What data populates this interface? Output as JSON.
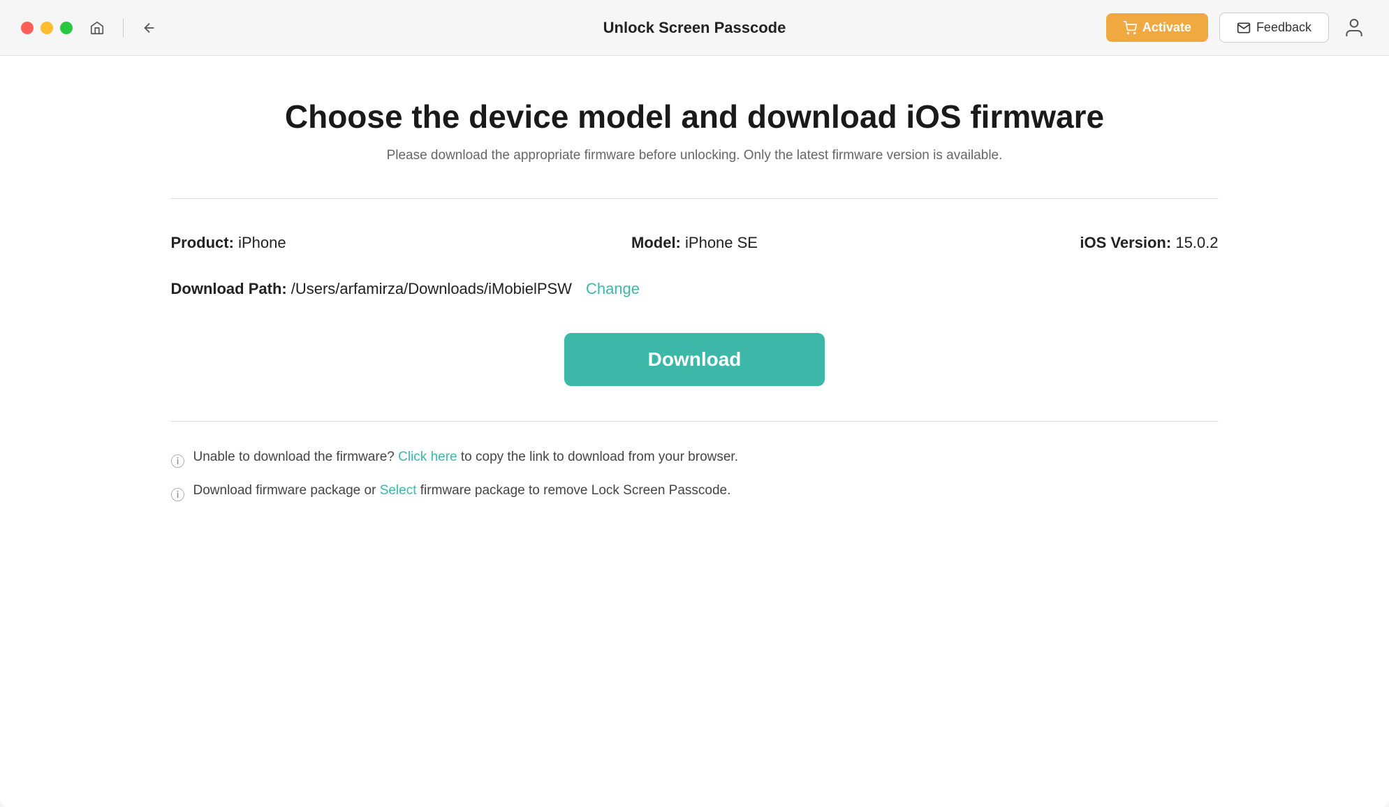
{
  "titleBar": {
    "title": "Unlock Screen Passcode",
    "activateLabel": "Activate",
    "feedbackLabel": "Feedback"
  },
  "page": {
    "mainTitle": "Choose the device model and download iOS firmware",
    "subtitle": "Please download the appropriate firmware before unlocking. Only the latest firmware version is available."
  },
  "deviceInfo": {
    "productLabel": "Product:",
    "productValue": "iPhone",
    "modelLabel": "Model:",
    "modelValue": "iPhone SE",
    "iosVersionLabel": "iOS Version:",
    "iosVersionValue": "15.0.2",
    "downloadPathLabel": "Download Path:",
    "downloadPathValue": "/Users/arfamirza/Downloads/iMobielPSW",
    "changeLabel": "Change"
  },
  "downloadButton": {
    "label": "Download"
  },
  "helpSection": {
    "item1": {
      "prefix": "Unable to download the firmware?",
      "linkText": "Click here",
      "suffix": "to copy the link to download from your browser."
    },
    "item2": {
      "prefix": "Download firmware package or",
      "linkText": "Select",
      "suffix": "firmware package to remove Lock Screen Passcode."
    }
  }
}
